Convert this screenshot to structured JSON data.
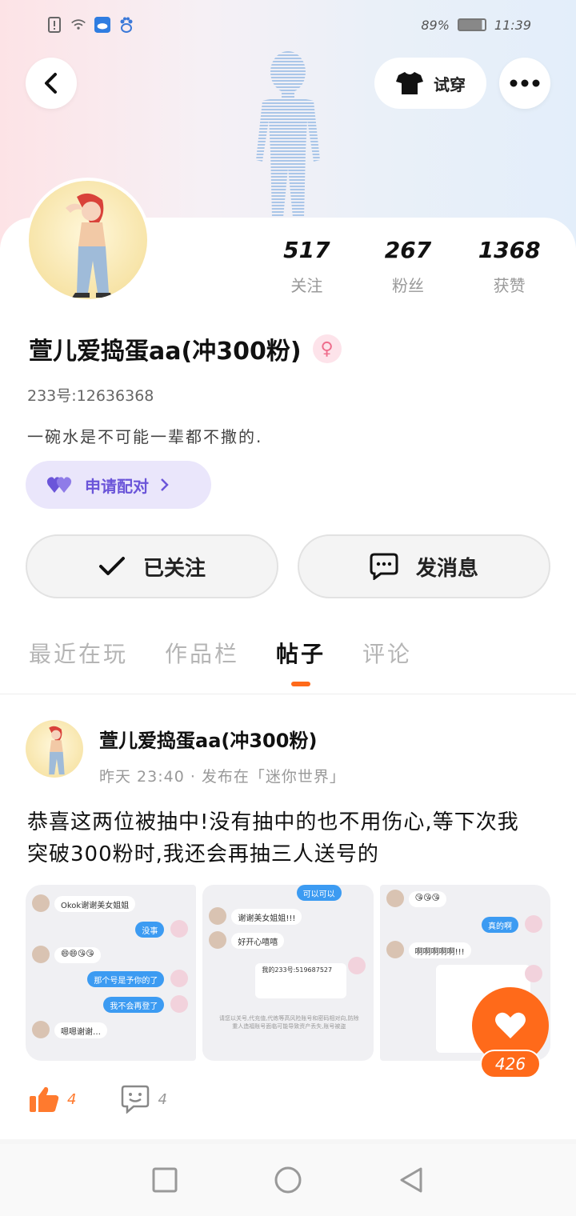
{
  "status_bar": {
    "battery": "89%",
    "time": "11:39"
  },
  "header": {
    "tryon_label": "试穿"
  },
  "profile": {
    "stats": [
      {
        "value": "517",
        "label": "关注"
      },
      {
        "value": "267",
        "label": "粉丝"
      },
      {
        "value": "1368",
        "label": "获赞"
      }
    ],
    "username": "萱儿爱捣蛋aa(冲300粉)",
    "gender_symbol": "♀",
    "uid": "233号:12636368",
    "bio": "一碗水是不可能一辈都不撒的.",
    "pair_label": "申请配对"
  },
  "actions": {
    "follow_label": "已关注",
    "message_label": "发消息"
  },
  "tabs": [
    {
      "label": "最近在玩",
      "active": false
    },
    {
      "label": "作品栏",
      "active": false
    },
    {
      "label": "帖子",
      "active": true
    },
    {
      "label": "评论",
      "active": false
    }
  ],
  "post": {
    "author": "萱儿爱捣蛋aa(冲300粉)",
    "meta": "昨天 23:40 · 发布在「迷你世界」",
    "text": "恭喜这两位被抽中!没有抽中的也不用伤心,等下次我突破300粉时,我还会再抽三人送号的",
    "image1": {
      "b1": "Okok谢谢美女姐姐",
      "b2": "没事",
      "b3": "😄😄😘😘",
      "b4": "那个号是予你的了",
      "b5": "我不会再登了",
      "b6": "嗯嗯谢谢…"
    },
    "image2": {
      "b1": "可以可以",
      "b2": "谢谢美女姐姐!!!",
      "b3": "好开心嘻嘻",
      "b4": "我的233号:519687527",
      "b5": "请您以关号,代充值,代练等高风险账号和密码相对向,防除重人造福账号面临可能导致资产丢失,账号被盗"
    },
    "image3": {
      "b1": "😘😘😘",
      "b2": "真的啊",
      "b3": "啊啊啊啊啊!!!"
    },
    "like_count": "4",
    "comment_count": "4",
    "floating_like_count": "426"
  }
}
